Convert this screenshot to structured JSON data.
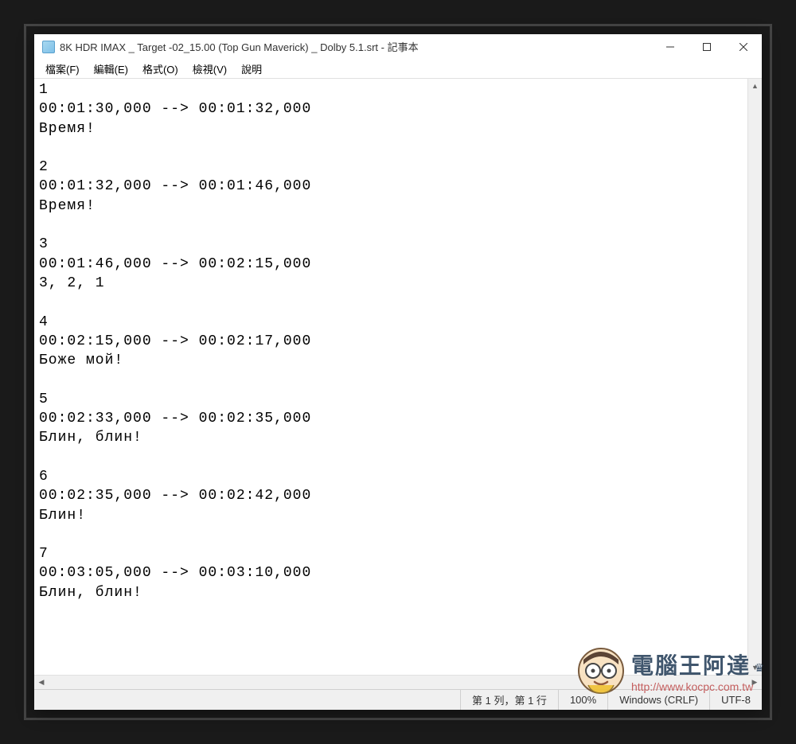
{
  "window": {
    "title": "8K HDR IMAX _ Target -02_15.00 (Top Gun Maverick) _ Dolby 5.1.srt - 記事本"
  },
  "menu": {
    "file": "檔案(F)",
    "edit": "編輯(E)",
    "format": "格式(O)",
    "view": "檢視(V)",
    "help": "說明"
  },
  "srt": [
    {
      "n": "1",
      "range": "00:01:30,000 --> 00:01:32,000",
      "text": "Время!"
    },
    {
      "n": "2",
      "range": "00:01:32,000 --> 00:01:46,000",
      "text": "Время!"
    },
    {
      "n": "3",
      "range": "00:01:46,000 --> 00:02:15,000",
      "text": "3, 2, 1"
    },
    {
      "n": "4",
      "range": "00:02:15,000 --> 00:02:17,000",
      "text": "Боже мой!"
    },
    {
      "n": "5",
      "range": "00:02:33,000 --> 00:02:35,000",
      "text": "Блин, блин!"
    },
    {
      "n": "6",
      "range": "00:02:35,000 --> 00:02:42,000",
      "text": "Блин!"
    },
    {
      "n": "7",
      "range": "00:03:05,000 --> 00:03:10,000",
      "text": "Блин, блин!"
    }
  ],
  "status": {
    "position": "第 1 列，第 1 行",
    "zoom": "100%",
    "lineending": "Windows (CRLF)",
    "encoding": "UTF-8"
  },
  "watermark": {
    "title": "電腦王阿達",
    "url": "http://www.kocpc.com.tw"
  }
}
